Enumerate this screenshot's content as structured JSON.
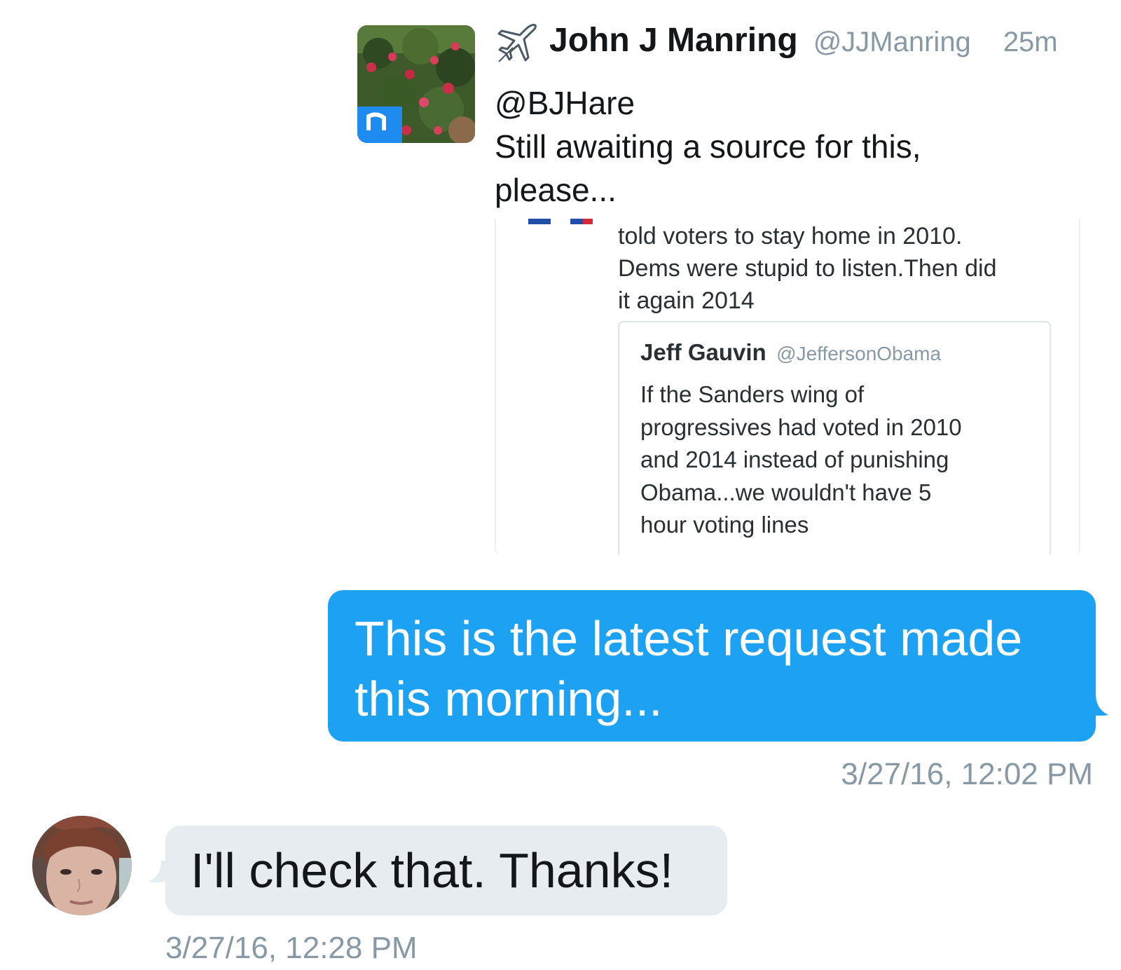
{
  "tweet": {
    "author_icon": "airplane-icon",
    "author_name": "John J Manring",
    "author_handle": "@JJManring",
    "time_ago": "25m",
    "text_lines": [
      "@BJHare",
      "Still awaiting a source for this,",
      "please..."
    ],
    "quoted": {
      "text_lines": [
        "told voters to stay home in 2010.",
        "Dems were stupid to listen.Then did",
        "it again 2014"
      ],
      "inner": {
        "author_name": "Jeff Gauvin",
        "author_handle": "@JeffersonObama",
        "text_lines": [
          "If the Sanders wing of",
          "progressives had voted in 2010",
          "and 2014 instead of punishing",
          "Obama...we wouldn't have 5",
          "hour voting lines"
        ]
      }
    }
  },
  "messages": {
    "outgoing": {
      "text_lines": [
        "This is the latest request made",
        "this morning..."
      ],
      "timestamp": "3/27/16, 12:02 PM"
    },
    "incoming": {
      "text": "I'll check that. Thanks!",
      "timestamp": "3/27/16, 12:28 PM"
    }
  },
  "colors": {
    "outgoing_bubble": "#1da1f2",
    "incoming_bubble": "#e6ecf0",
    "secondary_text": "#8899a6"
  }
}
